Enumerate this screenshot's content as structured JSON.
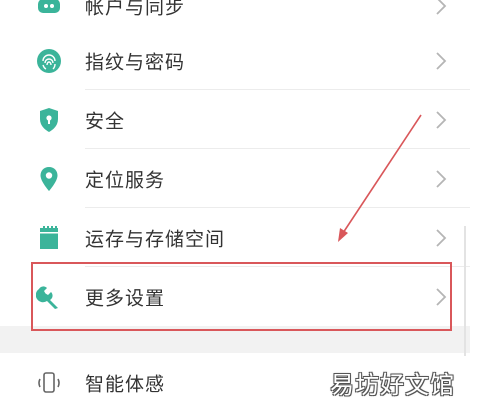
{
  "settings": {
    "items": [
      {
        "label": "帐户与同步",
        "icon": "cloud-sync-icon"
      },
      {
        "label": "指纹与密码",
        "icon": "fingerprint-icon"
      },
      {
        "label": "安全",
        "icon": "shield-icon"
      },
      {
        "label": "定位服务",
        "icon": "location-pin-icon"
      },
      {
        "label": "运存与存储空间",
        "icon": "sd-card-icon"
      },
      {
        "label": "更多设置",
        "icon": "wrench-icon"
      },
      {
        "label": "智能体感",
        "icon": "phone-motion-icon"
      }
    ]
  },
  "watermark": {
    "text": "易坊好文馆"
  },
  "colors": {
    "icon_green": "#3bb49a",
    "icon_gray": "#666666",
    "annotation_red": "#d9575a",
    "chevron": "#b5b5b5",
    "label": "#333333"
  }
}
